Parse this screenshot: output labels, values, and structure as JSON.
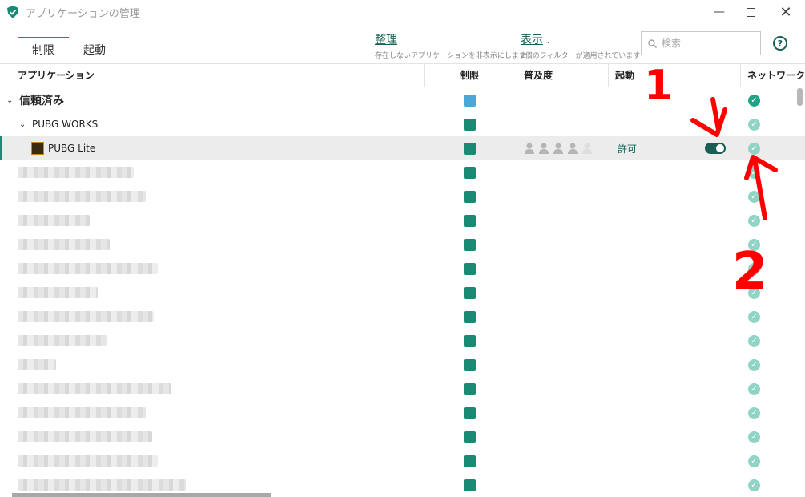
{
  "window": {
    "title": "アプリケーションの管理"
  },
  "tabs": [
    {
      "label": "制限"
    },
    {
      "label": "起動"
    }
  ],
  "actions": {
    "organize": {
      "label": "整理",
      "desc": "存在しないアプリケーションを非表示にします"
    },
    "display": {
      "label": "表示",
      "desc": "2個のフィルターが適用されています"
    }
  },
  "search": {
    "placeholder": "検索"
  },
  "help": {
    "label": "?"
  },
  "columns": {
    "application": "アプリケーション",
    "restriction": "制限",
    "popularity": "普及度",
    "startup": "起動",
    "network": "ネットワーク"
  },
  "groups": {
    "trusted": "信頼済み",
    "pubg_works": "PUBG WORKS"
  },
  "app": {
    "name": "PUBG Lite",
    "startup": "許可",
    "popularity_level": 4,
    "popularity_max": 5
  },
  "annotations": [
    "1",
    "2"
  ],
  "colors": {
    "accent": "#1b8a73",
    "blue": "#4aa8d8",
    "link": "#1a5e55",
    "annotation": "#ff0000"
  }
}
